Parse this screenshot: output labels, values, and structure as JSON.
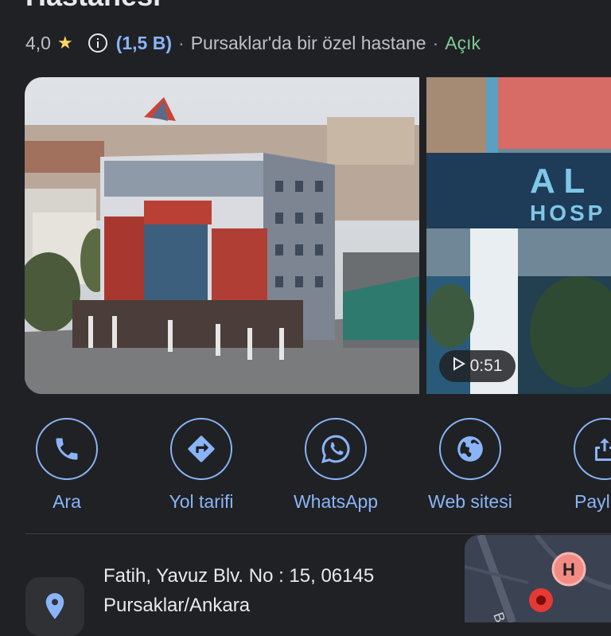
{
  "place": {
    "title_partial": "Hastanesi",
    "rating": "4,0",
    "reviews": "(1,5 B)",
    "category": "Pursaklar'da bir özel hastane",
    "status": "Açık"
  },
  "photos": {
    "video_duration": "0:51"
  },
  "actions": [
    {
      "label": "Ara",
      "icon": "phone-icon"
    },
    {
      "label": "Yol tarifi",
      "icon": "directions-icon"
    },
    {
      "label": "WhatsApp",
      "icon": "whatsapp-icon"
    },
    {
      "label": "Web sitesi",
      "icon": "globe-icon"
    },
    {
      "label": "Payl",
      "icon": "share-icon"
    }
  ],
  "address": {
    "line1": "Fatih, Yavuz Blv. No : 15, 06145",
    "line2": "Pursaklar/Ankara",
    "icon": "location-pin-icon"
  },
  "map": {
    "marker_letter": "H",
    "street_fragment": "Bele"
  },
  "colors": {
    "accent": "#8ab4f8",
    "open": "#81c995",
    "star": "#fdd663",
    "background": "#202124"
  }
}
